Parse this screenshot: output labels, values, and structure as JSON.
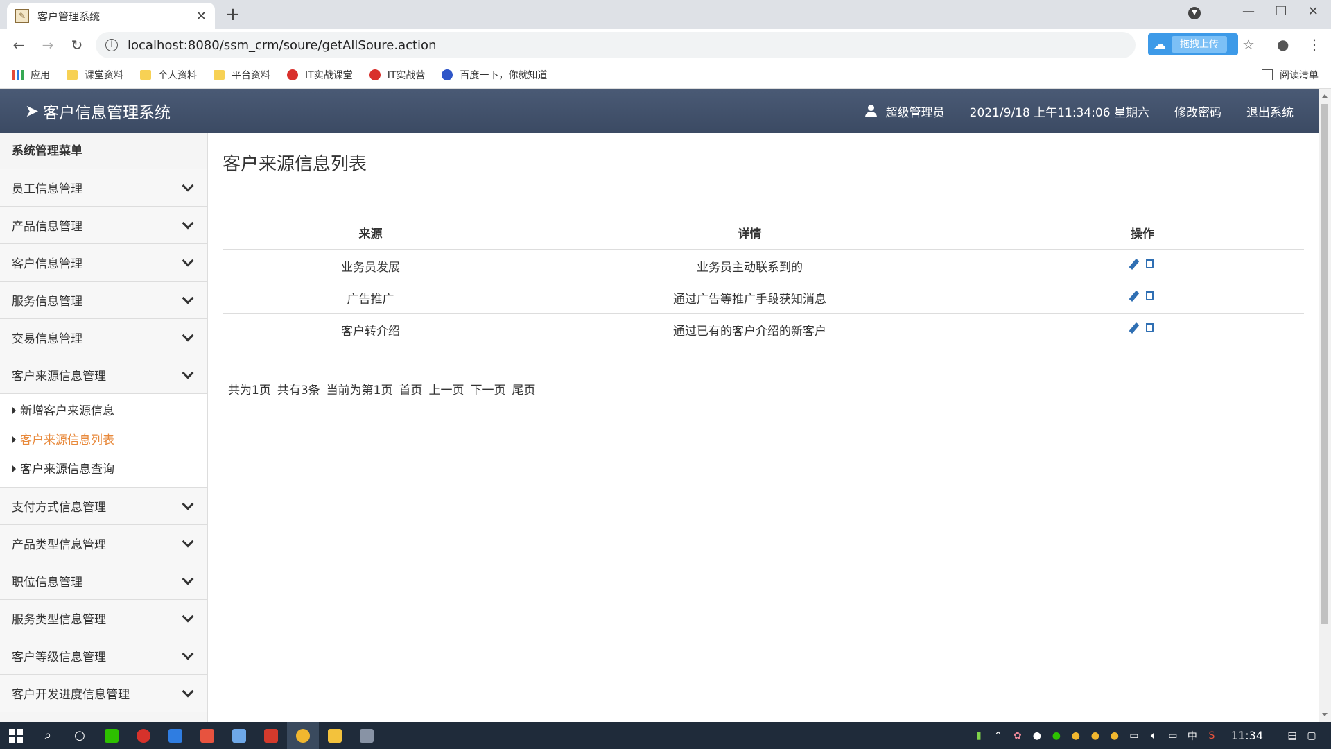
{
  "browser": {
    "tab_title": "客户管理系统",
    "url": "localhost:8080/ssm_crm/soure/getAllSoure.action",
    "upload_ext_label": "拖拽上传",
    "bookmarks": [
      "应用",
      "课堂资料",
      "个人资料",
      "平台资料",
      "IT实战课堂",
      "IT实战营",
      "百度一下，你就知道"
    ],
    "reading_list": "阅读清单"
  },
  "header": {
    "brand": "客户信息管理系统",
    "user": "超级管理员",
    "datetime": "2021/9/18 上午11:34:06 星期六",
    "change_password": "修改密码",
    "logout": "退出系统"
  },
  "sidebar": {
    "title": "系统管理菜单",
    "items_top": [
      "员工信息管理",
      "产品信息管理",
      "客户信息管理",
      "服务信息管理",
      "交易信息管理",
      "客户来源信息管理"
    ],
    "submenu": [
      "新增客户来源信息",
      "客户来源信息列表",
      "客户来源信息查询"
    ],
    "items_bottom": [
      "支付方式信息管理",
      "产品类型信息管理",
      "职位信息管理",
      "服务类型信息管理",
      "客户等级信息管理",
      "客户开发进度信息管理"
    ]
  },
  "main": {
    "title": "客户来源信息列表",
    "columns": [
      "来源",
      "详情",
      "操作"
    ],
    "rows": [
      [
        "业务员发展",
        "业务员主动联系到的"
      ],
      [
        "广告推广",
        "通过广告等推广手段获知消息"
      ],
      [
        "客户转介绍",
        "通过已有的客户介绍的新客户"
      ]
    ],
    "pager": {
      "total_pages": "共为1页",
      "total_records": "共有3条",
      "current": "当前为第1页",
      "first": "首页",
      "prev": "上一页",
      "next": "下一页",
      "last": "尾页"
    }
  },
  "taskbar": {
    "time": "11:34",
    "ime": "中"
  },
  "colors": {
    "header_bg": "#3b4a63",
    "active_submenu": "#e8893b",
    "icon_blue": "#2f6fb3"
  }
}
